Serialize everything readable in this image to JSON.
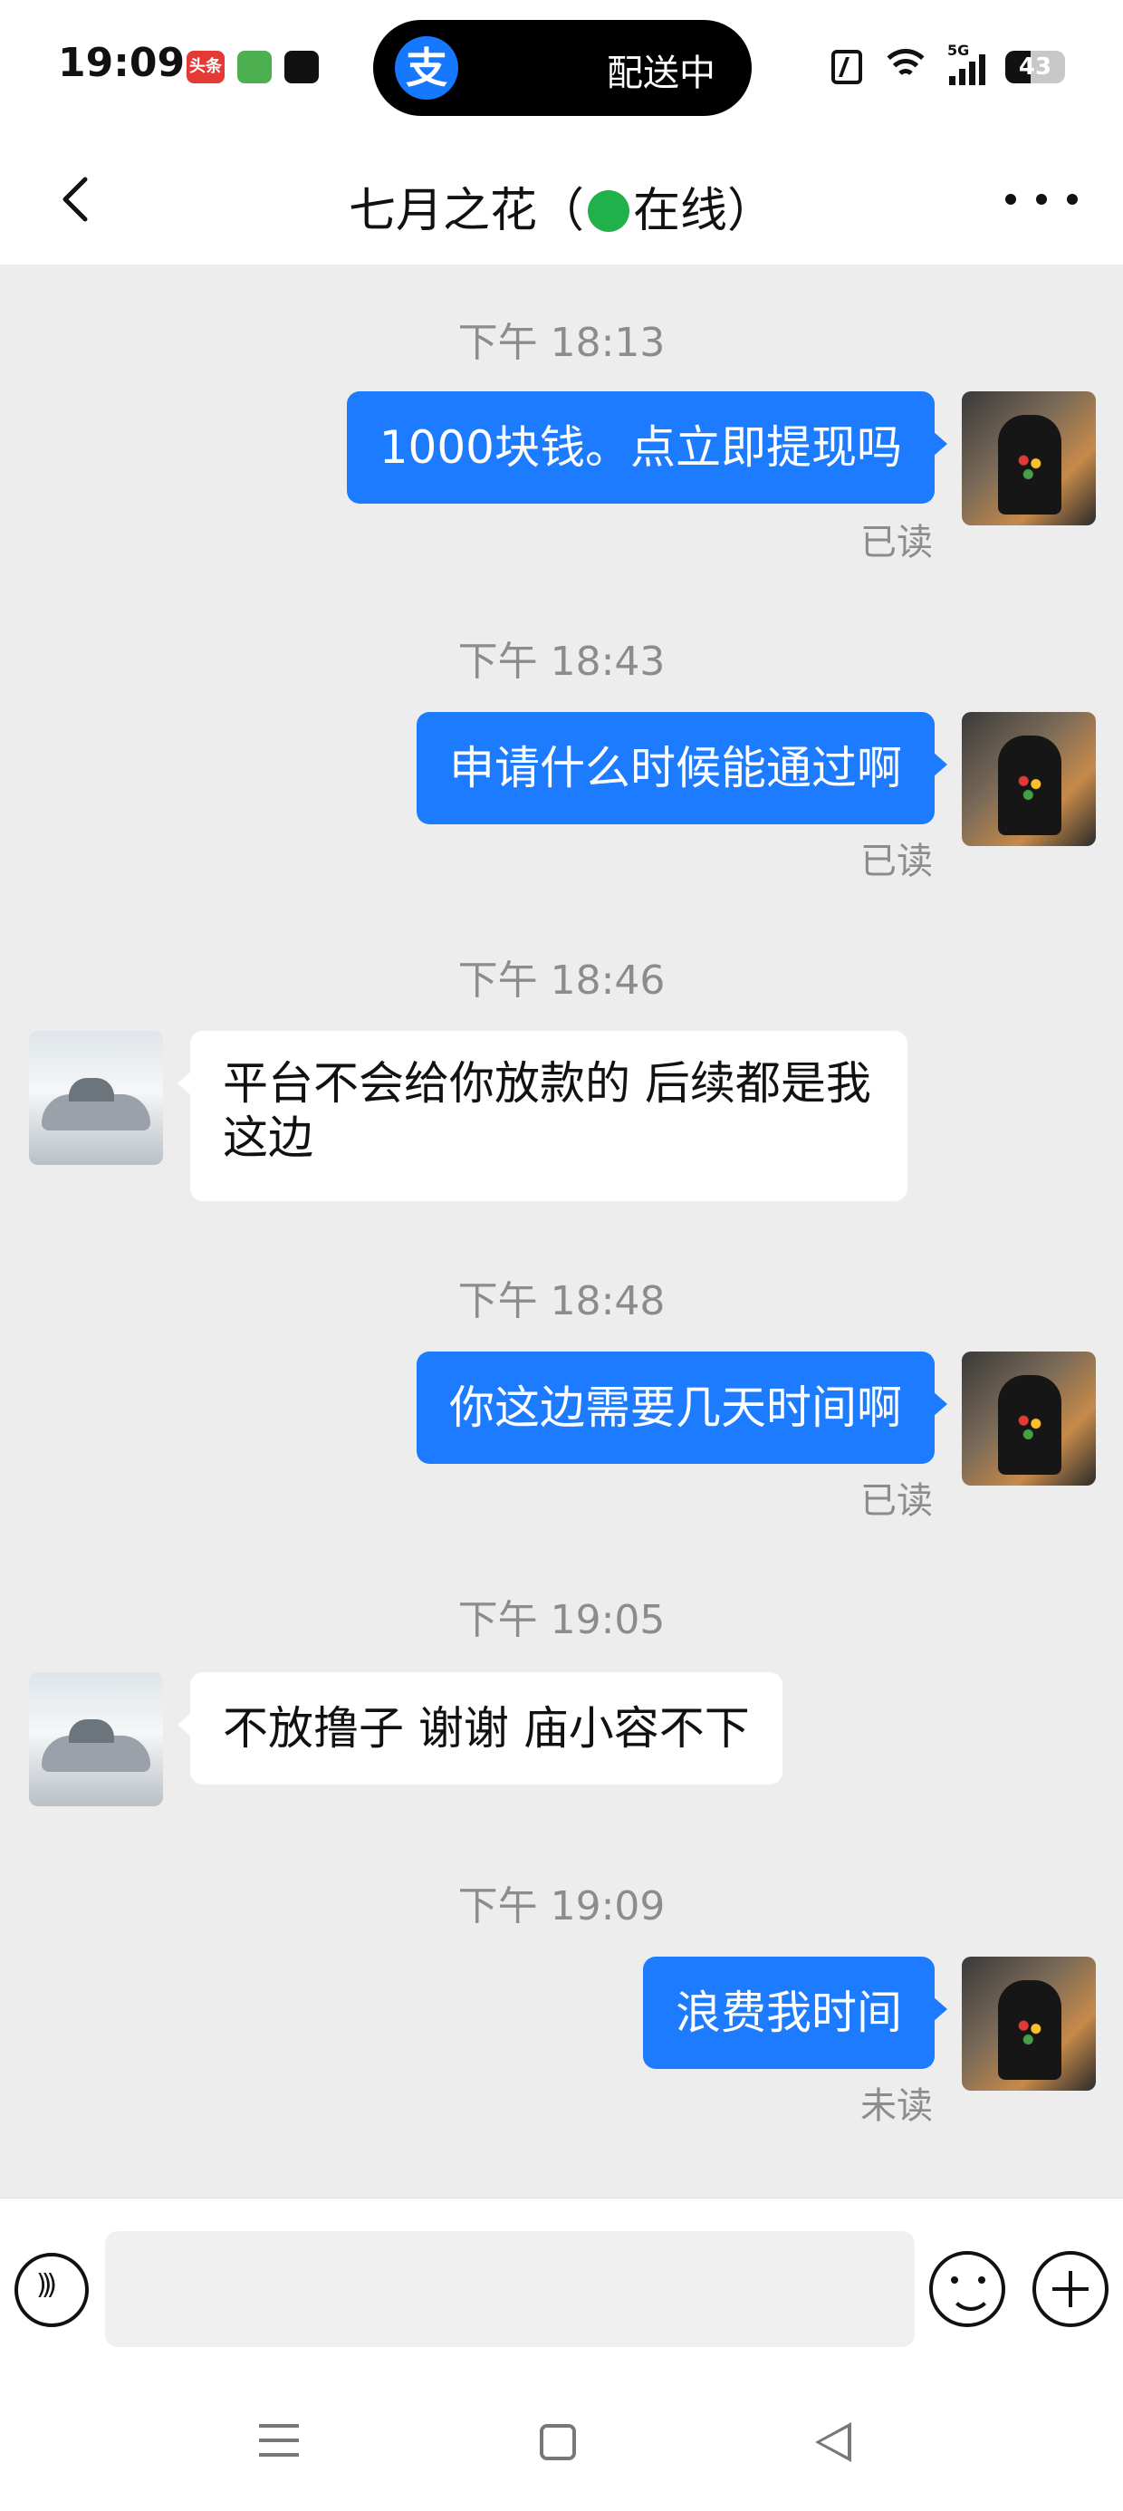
{
  "status_bar": {
    "time": "19:09",
    "toutiao_label": "头条",
    "island_text": "配送中",
    "island_logo": "支",
    "network_label": "5G",
    "battery_level": "43",
    "icons": [
      "toutiao-icon",
      "messenger-icon",
      "music-icon",
      "nfc-icon",
      "wifi-icon",
      "signal-5g-icon",
      "battery-icon"
    ]
  },
  "header": {
    "title_name": "七月之花（",
    "title_status": "在线）",
    "status_dot_color": "#21b14b"
  },
  "messages": [
    {
      "time": "下午 18:13",
      "side": "me",
      "text": "1000块钱。点立即提现吗",
      "receipt": "已读"
    },
    {
      "time": "下午 18:43",
      "side": "me",
      "text": "申请什么时候能通过啊",
      "receipt": "已读"
    },
    {
      "time": "下午 18:46",
      "side": "them",
      "text": "平台不会给你放款的 后续都是我这边"
    },
    {
      "time": "下午 18:48",
      "side": "me",
      "text": "你这边需要几天时间啊",
      "receipt": "已读"
    },
    {
      "time": "下午 19:05",
      "side": "them",
      "text": "不放撸子 谢谢 庙小容不下"
    },
    {
      "time": "下午 19:09",
      "side": "me",
      "text": "浪费我时间",
      "receipt": "未读"
    }
  ],
  "input": {
    "value": "",
    "placeholder": ""
  },
  "colors": {
    "my_bubble": "#1d7bff",
    "their_bubble": "#ffffff",
    "chat_background": "#ededed"
  }
}
